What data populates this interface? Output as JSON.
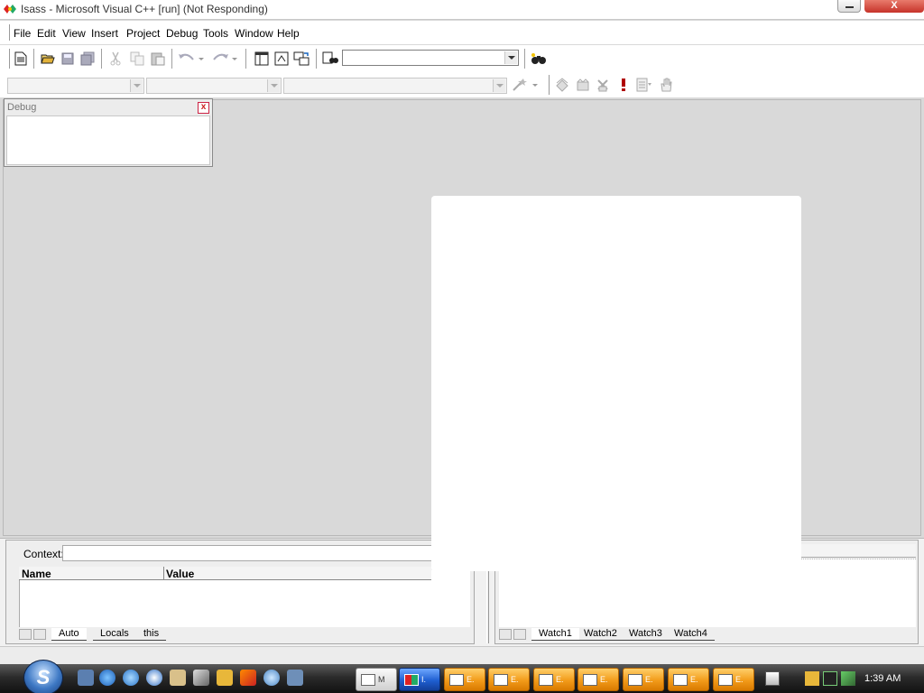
{
  "window": {
    "title": "Isass - Microsoft Visual C++ [run] (Not Responding)",
    "close_glyph": "X"
  },
  "menu": {
    "items": [
      "File",
      "Edit",
      "View",
      "Insert",
      "Project",
      "Debug",
      "Tools",
      "Window",
      "Help"
    ]
  },
  "toolbar": {
    "find_combo_value": "",
    "icons": [
      "new-file-icon",
      "open-folder-icon",
      "save-icon",
      "save-all-icon",
      "cut-icon",
      "copy-icon",
      "paste-icon",
      "undo-icon",
      "redo-icon",
      "workspace-icon",
      "output-icon",
      "window-list-icon",
      "find-in-files-icon",
      "find-binoculars-icon"
    ]
  },
  "wizard_bar": {
    "class_combo": "",
    "filter_combo": "",
    "members_combo": "",
    "icons": [
      "wizard-wand-icon",
      "compile-icon",
      "build-icon",
      "stop-build-icon",
      "execute-icon",
      "insert-breakpoint-icon",
      "hand-icon"
    ]
  },
  "debug_panel": {
    "title": "Debug",
    "close_glyph": "x"
  },
  "variables": {
    "context_label": "Context:",
    "columns": [
      "Name",
      "Value"
    ],
    "tabs": [
      "Auto",
      "Locals",
      "this"
    ]
  },
  "watch": {
    "tabs": [
      "Watch1",
      "Watch2",
      "Watch3",
      "Watch4"
    ]
  },
  "taskbar": {
    "start_glyph": "S",
    "buttons": [
      {
        "label": "M",
        "style": "white"
      },
      {
        "label": "I.",
        "style": "blue"
      },
      {
        "label": "E.",
        "style": "orange"
      },
      {
        "label": "E.",
        "style": "orange"
      },
      {
        "label": "E.",
        "style": "orange"
      },
      {
        "label": "E.",
        "style": "orange"
      },
      {
        "label": "E.",
        "style": "orange"
      },
      {
        "label": "E.",
        "style": "orange"
      },
      {
        "label": "E.",
        "style": "orange"
      }
    ],
    "clock": "1:39 AM"
  },
  "colors": {
    "workspace": "#d9d9d9",
    "taskbar_button_orange": "#f29b1a",
    "taskbar_button_blue": "#1f5fd1",
    "close_button": "#c6332a"
  }
}
